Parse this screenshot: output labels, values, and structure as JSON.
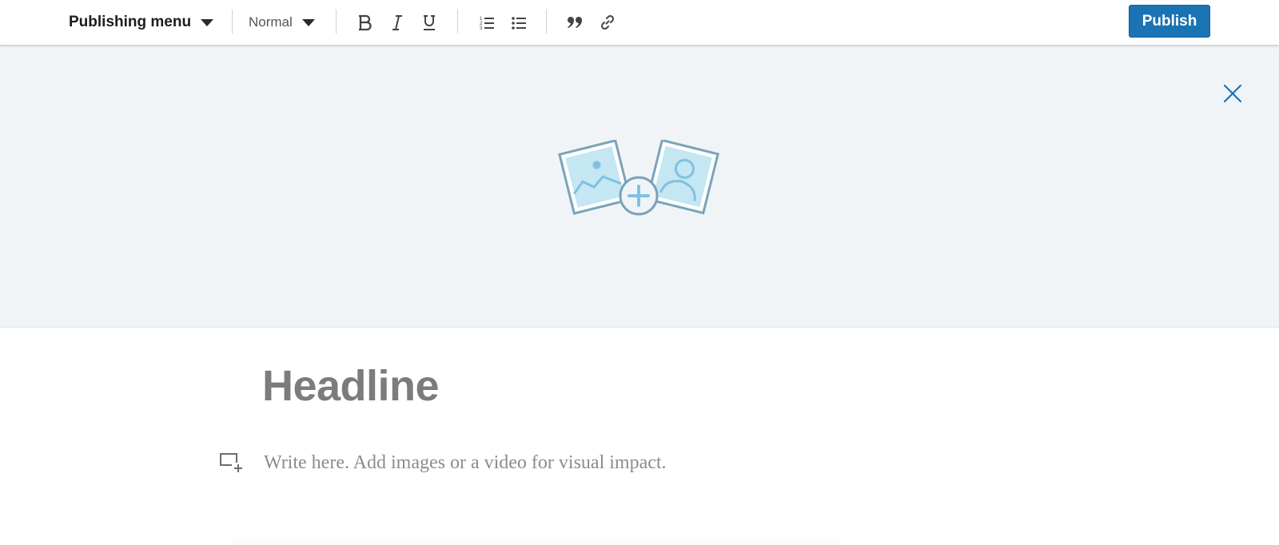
{
  "toolbar": {
    "publishing_menu_label": "Publishing menu",
    "text_style": {
      "selected": "Normal"
    },
    "buttons": {
      "bold": "bold-icon",
      "italic": "italic-icon",
      "underline": "underline-icon",
      "ordered_list": "numbered-list-icon",
      "unordered_list": "bulleted-list-icon",
      "quote": "quote-icon",
      "link": "link-icon"
    },
    "publish_label": "Publish"
  },
  "cover_image": {
    "upload_icon": "add-image-icon",
    "close_icon": "close-icon"
  },
  "editor": {
    "headline_placeholder": "Headline",
    "body_placeholder": "Write here. Add images or a video for visual impact.",
    "media_icon": "add-media-icon"
  },
  "colors": {
    "accent": "#1a73b3",
    "cover_bg": "#f1f4f6",
    "placeholder_text": "#7a7c7e",
    "illustration_stroke": "#7aa3bc",
    "illustration_fill": "#c5e6f3"
  }
}
